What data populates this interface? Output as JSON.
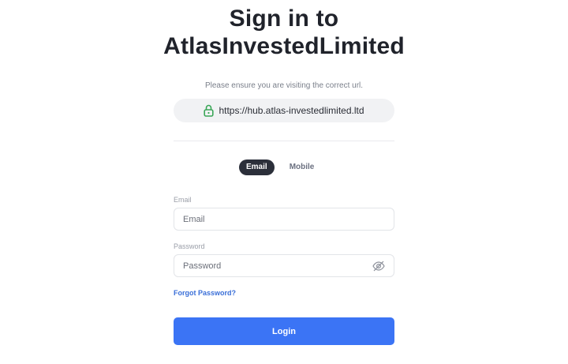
{
  "header": {
    "title_line1": "Sign in to",
    "title_line2": "AtlasInvestedLimited"
  },
  "url_check": {
    "note": "Please ensure you are visiting the correct url.",
    "url": "https://hub.atlas-investedlimited.ltd",
    "icon": "lock-icon",
    "icon_color": "#3aa657"
  },
  "tabs": [
    {
      "label": "Email",
      "active": true
    },
    {
      "label": "Mobile",
      "active": false
    }
  ],
  "form": {
    "email_label": "Email",
    "email_placeholder": "Email",
    "password_label": "Password",
    "password_placeholder": "Password",
    "password_icon": "eye-off-icon",
    "forgot_label": "Forgot Password?",
    "submit_label": "Login"
  },
  "colors": {
    "primary": "#3b74f5",
    "link": "#3a6fd8",
    "tab_active_bg": "#2b2f3a"
  }
}
